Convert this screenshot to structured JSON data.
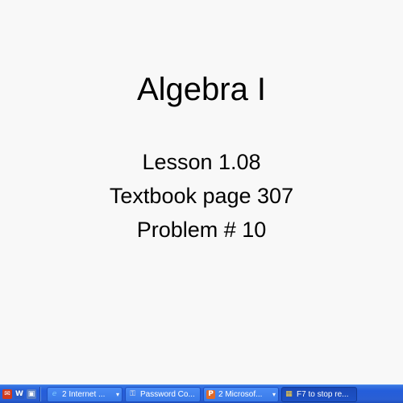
{
  "slide": {
    "title": "Algebra I",
    "lines": [
      "Lesson 1.08",
      "Textbook page 307",
      "Problem # 10"
    ]
  },
  "taskbar": {
    "quick_launch": [
      {
        "icon": "outlook-icon",
        "color": "#d03a1c",
        "glyph": ""
      },
      {
        "icon": "word-icon",
        "color": "#2b5bc4",
        "glyph": "W"
      },
      {
        "icon": "calendar-icon",
        "color": "#5a7fc4",
        "glyph": "▣"
      }
    ],
    "buttons": [
      {
        "label": "2 Internet ...",
        "icon": "internet-explorer-icon",
        "glyph": "e",
        "icon_color": "#7ec8ff",
        "has_dropdown": true,
        "active": false
      },
      {
        "label": "Password Co...",
        "icon": "lock-icon",
        "glyph": "🔒",
        "icon_color": "#e8e8e8",
        "has_dropdown": false,
        "active": false
      },
      {
        "label": "2 Microsof...",
        "icon": "powerpoint-icon",
        "glyph": "P",
        "icon_color": "#e06a2a",
        "has_dropdown": true,
        "active": false
      },
      {
        "label": "F7 to stop re...",
        "icon": "recorder-icon",
        "glyph": "■",
        "icon_color": "#ffd23c",
        "has_dropdown": false,
        "active": true
      }
    ]
  }
}
